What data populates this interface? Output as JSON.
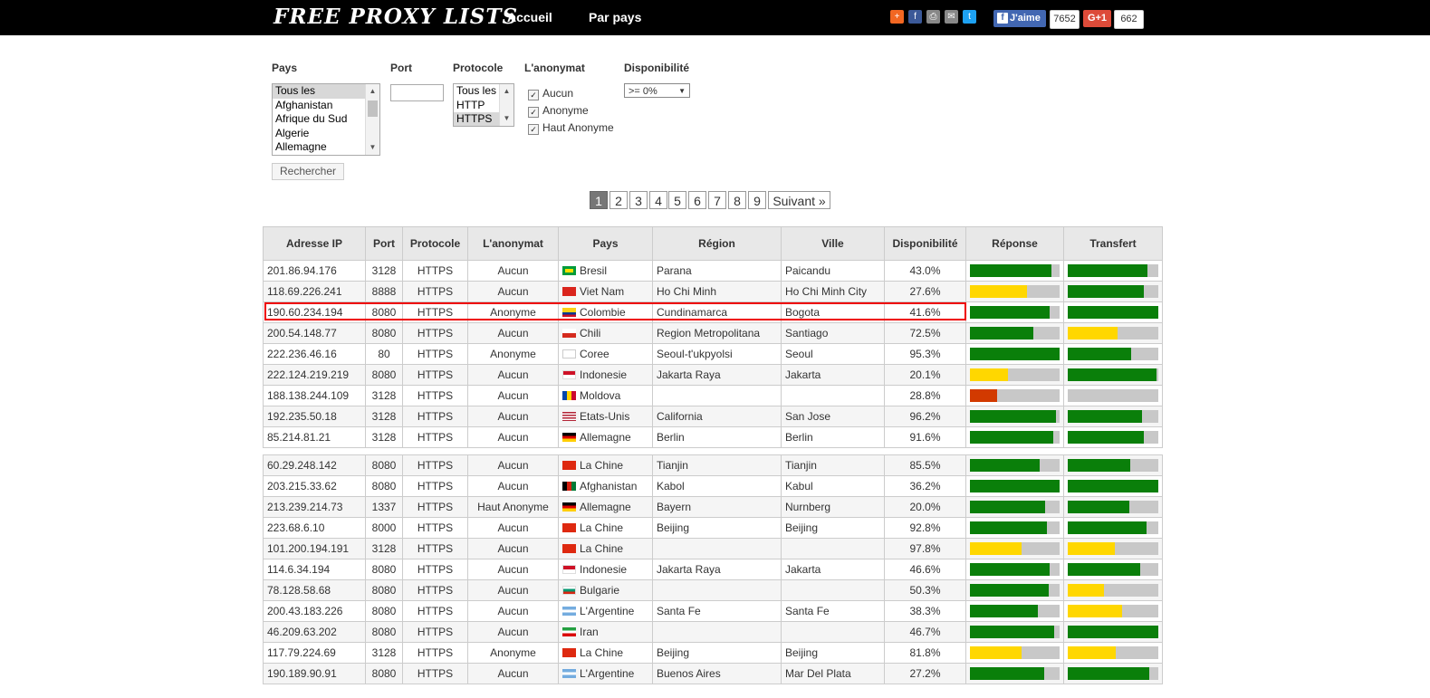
{
  "header": {
    "logo": "FREE PROXY LISTS",
    "nav": [
      "Accueil",
      "Par pays"
    ],
    "like_label": "J'aime",
    "like_count": "7652",
    "gplus_label": "G+1",
    "gplus_count": "662"
  },
  "filters": {
    "pays_label": "Pays",
    "pays_options": [
      "Tous les",
      "Afghanistan",
      "Afrique du Sud",
      "Algerie",
      "Allemagne"
    ],
    "port_label": "Port",
    "port_value": "",
    "protocole_label": "Protocole",
    "protocole_options": [
      "Tous les",
      "HTTP",
      "HTTPS"
    ],
    "anonymat_label": "L'anonymat",
    "anonymat_options": [
      "Aucun",
      "Anonyme",
      "Haut Anonyme"
    ],
    "dispo_label": "Disponibilité",
    "dispo_value": ">= 0%",
    "search_button": "Rechercher"
  },
  "pagination": {
    "pages": [
      "1",
      "2",
      "3",
      "4",
      "5",
      "6",
      "7",
      "8",
      "9"
    ],
    "next": "Suivant »"
  },
  "table": {
    "headers": [
      "Adresse IP",
      "Port",
      "Protocole",
      "L'anonymat",
      "Pays",
      "Région",
      "Ville",
      "Disponibilité",
      "Réponse",
      "Transfert"
    ],
    "rows": [
      {
        "ip": "201.86.94.176",
        "port": "3128",
        "proto": "HTTPS",
        "anon": "Aucun",
        "country": "Bresil",
        "region": "Parana",
        "city": "Paicandu",
        "dispo": "43.0%",
        "resp": 0.91,
        "resp_color": "green",
        "trans": 0.88,
        "trans_color": "green"
      },
      {
        "ip": "118.69.226.241",
        "port": "8888",
        "proto": "HTTPS",
        "anon": "Aucun",
        "country": "Viet Nam",
        "region": "Ho Chi Minh",
        "city": "Ho Chi Minh City",
        "dispo": "27.6%",
        "resp": 0.64,
        "resp_color": "yellow",
        "trans": 0.84,
        "trans_color": "green"
      },
      {
        "ip": "190.60.234.194",
        "port": "8080",
        "proto": "HTTPS",
        "anon": "Anonyme",
        "country": "Colombie",
        "region": "Cundinamarca",
        "city": "Bogota",
        "dispo": "41.6%",
        "resp": 0.89,
        "resp_color": "green",
        "trans": 1.0,
        "trans_color": "green"
      },
      {
        "ip": "200.54.148.77",
        "port": "8080",
        "proto": "HTTPS",
        "anon": "Aucun",
        "country": "Chili",
        "region": "Region Metropolitana",
        "city": "Santiago",
        "dispo": "72.5%",
        "resp": 0.71,
        "resp_color": "green",
        "trans": 0.55,
        "trans_color": "yellow"
      },
      {
        "ip": "222.236.46.16",
        "port": "80",
        "proto": "HTTPS",
        "anon": "Anonyme",
        "country": "Coree",
        "region": "Seoul-t'ukpyolsi",
        "city": "Seoul",
        "dispo": "95.3%",
        "resp": 1.0,
        "resp_color": "green",
        "trans": 0.7,
        "trans_color": "green"
      },
      {
        "ip": "222.124.219.219",
        "port": "8080",
        "proto": "HTTPS",
        "anon": "Aucun",
        "country": "Indonesie",
        "region": "Jakarta Raya",
        "city": "Jakarta",
        "dispo": "20.1%",
        "resp": 0.42,
        "resp_color": "yellow",
        "trans": 0.98,
        "trans_color": "green"
      },
      {
        "ip": "188.138.244.109",
        "port": "3128",
        "proto": "HTTPS",
        "anon": "Aucun",
        "country": "Moldova",
        "region": "",
        "city": "",
        "dispo": "28.8%",
        "resp": 0.3,
        "resp_color": "red",
        "trans": 0.0,
        "trans_color": "green"
      },
      {
        "ip": "192.235.50.18",
        "port": "3128",
        "proto": "HTTPS",
        "anon": "Aucun",
        "country": "Etats-Unis",
        "region": "California",
        "city": "San Jose",
        "dispo": "96.2%",
        "resp": 0.96,
        "resp_color": "green",
        "trans": 0.82,
        "trans_color": "green"
      },
      {
        "ip": "85.214.81.21",
        "port": "3128",
        "proto": "HTTPS",
        "anon": "Aucun",
        "country": "Allemagne",
        "region": "Berlin",
        "city": "Berlin",
        "dispo": "91.6%",
        "resp": 0.93,
        "resp_color": "green",
        "trans": 0.84,
        "trans_color": "green"
      },
      {
        "gap": true
      },
      {
        "ip": "60.29.248.142",
        "port": "8080",
        "proto": "HTTPS",
        "anon": "Aucun",
        "country": "La Chine",
        "region": "Tianjin",
        "city": "Tianjin",
        "dispo": "85.5%",
        "resp": 0.78,
        "resp_color": "green",
        "trans": 0.69,
        "trans_color": "green"
      },
      {
        "ip": "203.215.33.62",
        "port": "8080",
        "proto": "HTTPS",
        "anon": "Aucun",
        "country": "Afghanistan",
        "region": "Kabol",
        "city": "Kabul",
        "dispo": "36.2%",
        "resp": 1.0,
        "resp_color": "green",
        "trans": 1.0,
        "trans_color": "green"
      },
      {
        "ip": "213.239.214.73",
        "port": "1337",
        "proto": "HTTPS",
        "anon": "Haut Anonyme",
        "country": "Allemagne",
        "region": "Bayern",
        "city": "Nurnberg",
        "dispo": "20.0%",
        "resp": 0.84,
        "resp_color": "green",
        "trans": 0.68,
        "trans_color": "green"
      },
      {
        "ip": "223.68.6.10",
        "port": "8000",
        "proto": "HTTPS",
        "anon": "Aucun",
        "country": "La Chine",
        "region": "Beijing",
        "city": "Beijing",
        "dispo": "92.8%",
        "resp": 0.86,
        "resp_color": "green",
        "trans": 0.87,
        "trans_color": "green"
      },
      {
        "ip": "101.200.194.191",
        "port": "3128",
        "proto": "HTTPS",
        "anon": "Aucun",
        "country": "La Chine",
        "region": "",
        "city": "",
        "dispo": "97.8%",
        "resp": 0.58,
        "resp_color": "yellow",
        "trans": 0.52,
        "trans_color": "yellow"
      },
      {
        "ip": "114.6.34.194",
        "port": "8080",
        "proto": "HTTPS",
        "anon": "Aucun",
        "country": "Indonesie",
        "region": "Jakarta Raya",
        "city": "Jakarta",
        "dispo": "46.6%",
        "resp": 0.89,
        "resp_color": "green",
        "trans": 0.8,
        "trans_color": "green"
      },
      {
        "ip": "78.128.58.68",
        "port": "8080",
        "proto": "HTTPS",
        "anon": "Aucun",
        "country": "Bulgarie",
        "region": "",
        "city": "",
        "dispo": "50.3%",
        "resp": 0.88,
        "resp_color": "green",
        "trans": 0.4,
        "trans_color": "yellow"
      },
      {
        "ip": "200.43.183.226",
        "port": "8080",
        "proto": "HTTPS",
        "anon": "Aucun",
        "country": "L'Argentine",
        "region": "Santa Fe",
        "city": "Santa Fe",
        "dispo": "38.3%",
        "resp": 0.76,
        "resp_color": "green",
        "trans": 0.6,
        "trans_color": "yellow"
      },
      {
        "ip": "46.209.63.202",
        "port": "8080",
        "proto": "HTTPS",
        "anon": "Aucun",
        "country": "Iran",
        "region": "",
        "city": "",
        "dispo": "46.7%",
        "resp": 0.94,
        "resp_color": "green",
        "trans": 1.0,
        "trans_color": "green"
      },
      {
        "ip": "117.79.224.69",
        "port": "3128",
        "proto": "HTTPS",
        "anon": "Anonyme",
        "country": "La Chine",
        "region": "Beijing",
        "city": "Beijing",
        "dispo": "81.8%",
        "resp": 0.58,
        "resp_color": "yellow",
        "trans": 0.53,
        "trans_color": "yellow"
      },
      {
        "ip": "190.189.90.91",
        "port": "8080",
        "proto": "HTTPS",
        "anon": "Aucun",
        "country": "L'Argentine",
        "region": "Buenos Aires",
        "city": "Mar Del Plata",
        "dispo": "27.2%",
        "resp": 0.83,
        "resp_color": "green",
        "trans": 0.9,
        "trans_color": "green"
      }
    ]
  },
  "colors": {
    "green": "#0a7f0a",
    "yellow": "#ffd700",
    "red": "#d23a00",
    "highlight": "#e00000"
  }
}
